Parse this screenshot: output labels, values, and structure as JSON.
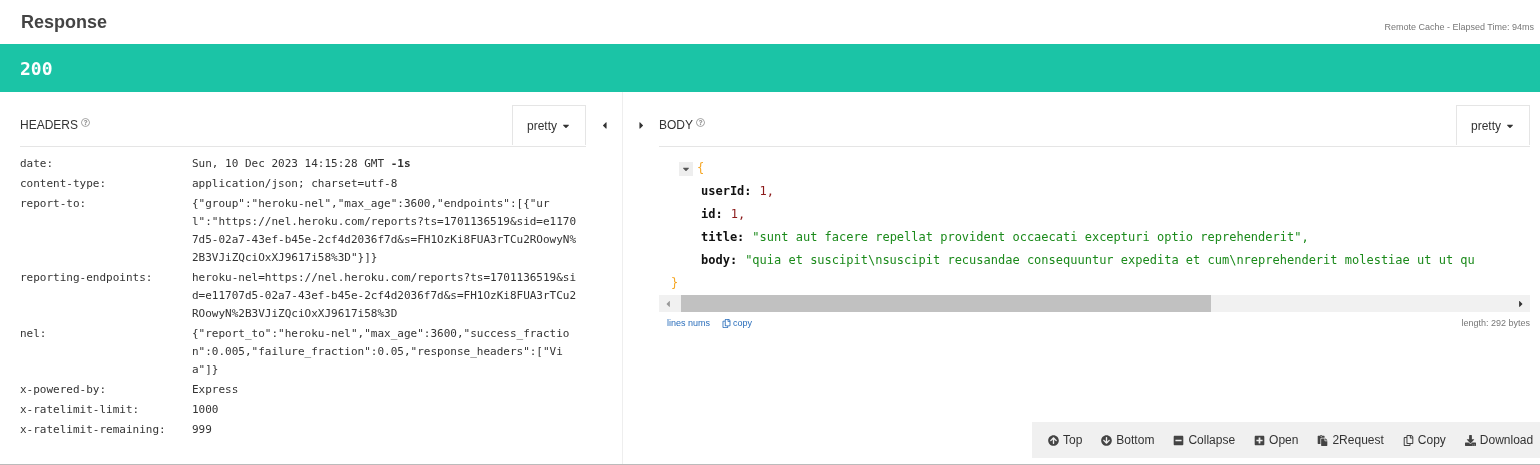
{
  "title": "Response",
  "cache_info": "Remote Cache - Elapsed Time: 94ms",
  "status": "200",
  "headers_panel": {
    "label": "HEADERS",
    "format": "pretty",
    "rows": [
      {
        "name": "date:",
        "value": "Sun, 10 Dec 2023 14:15:28 GMT **-1s**"
      },
      {
        "name": "content-type:",
        "value": "application/json; charset=utf-8"
      },
      {
        "name": "report-to:",
        "value": "{\"group\":\"heroku-nel\",\"max_age\":3600,\"endpoints\":[{\"url\":\"https://nel.heroku.com/reports?ts=1701136519&sid=e11707d5-02a7-43ef-b45e-2cf4d2036f7d&s=FH1OzKi8FUA3rTCu2ROowyN%2B3VJiZQciOxXJ9617i58%3D\"}]}"
      },
      {
        "name": "reporting-endpoints:",
        "value": "heroku-nel=https://nel.heroku.com/reports?ts=1701136519&sid=e11707d5-02a7-43ef-b45e-2cf4d2036f7d&s=FH1OzKi8FUA3rTCu2ROowyN%2B3VJiZQciOxXJ9617i58%3D"
      },
      {
        "name": "nel:",
        "value": "{\"report_to\":\"heroku-nel\",\"max_age\":3600,\"success_fraction\":0.005,\"failure_fraction\":0.05,\"response_headers\":[\"Via\"]}"
      },
      {
        "name": "x-powered-by:",
        "value": "Express"
      },
      {
        "name": "x-ratelimit-limit:",
        "value": "1000"
      },
      {
        "name": "x-ratelimit-remaining:",
        "value": "999"
      }
    ]
  },
  "body_panel": {
    "label": "BODY",
    "format": "pretty",
    "open_brace": "{",
    "close_brace": "}",
    "expanded": true,
    "fields": [
      {
        "key": "userId:",
        "value": "1,",
        "kind": "number"
      },
      {
        "key": "id:",
        "value": "1,",
        "kind": "number"
      },
      {
        "key": "title:",
        "value": "\"sunt aut facere repellat provident occaecati excepturi optio reprehenderit\",",
        "kind": "string"
      },
      {
        "key": "body:",
        "value": "\"quia et suscipit\\nsuscipit recusandae consequuntur expedita et cum\\nreprehenderit molestiae ut ut qu",
        "kind": "string"
      }
    ],
    "links": [
      "lines nums",
      "copy"
    ],
    "length": "length: 292 bytes"
  },
  "toolbar": [
    "Top",
    "Bottom",
    "Collapse",
    "Open",
    "2Request",
    "Copy",
    "Download"
  ]
}
